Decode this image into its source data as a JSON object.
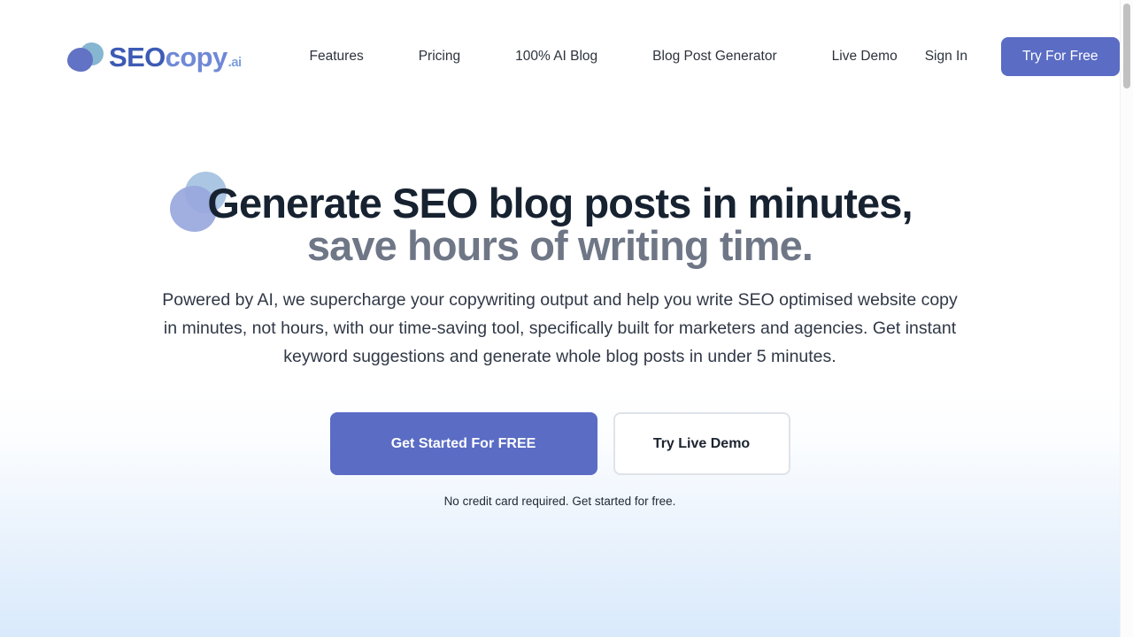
{
  "header": {
    "logo": {
      "mark_icon": "overlapping-circles-icon",
      "text_seo": "SEO",
      "text_copy": "copy",
      "text_ai": ".ai",
      "color_seo": "#3d5bb5",
      "color_copy": "#7089d6",
      "color_mark_primary": "#6272c4",
      "color_mark_secondary": "#68a4c4"
    },
    "nav": [
      {
        "label": "Features"
      },
      {
        "label": "Pricing"
      },
      {
        "label": "100% AI Blog"
      },
      {
        "label": "Blog Post Generator"
      },
      {
        "label": "Live Demo"
      }
    ],
    "signin_label": "Sign In",
    "try_free_label": "Try For Free",
    "try_free_color": "#5a6cc4"
  },
  "hero": {
    "headline_line1": "Generate SEO blog posts in minutes,",
    "headline_line2": "save hours of writing time.",
    "headline_line1_color": "#172231",
    "headline_line2_color": "#6f7787",
    "subhead": "Powered by AI, we supercharge your copywriting output and help you write SEO optimised website copy in minutes, not hours, with our time-saving tool, specifically built for marketers and agencies. Get instant keyword suggestions and generate whole blog posts in under 5 minutes.",
    "decoration_icon": "decorative-blob-circles",
    "decoration_color_light": "#a7c3e2",
    "decoration_color_periwinkle": "#98a7dd",
    "cta_primary_label": "Get Started For FREE",
    "cta_primary_color": "#5a6cc4",
    "cta_secondary_label": "Try Live Demo",
    "cta_note": "No credit card required. Get started for free."
  },
  "page": {
    "background_top_color": "#ffffff",
    "background_bottom_color": "#d9eafc"
  },
  "scrollbar": {
    "thumb_color": "#c1c1c1",
    "track_color": "#fcfcfc"
  }
}
